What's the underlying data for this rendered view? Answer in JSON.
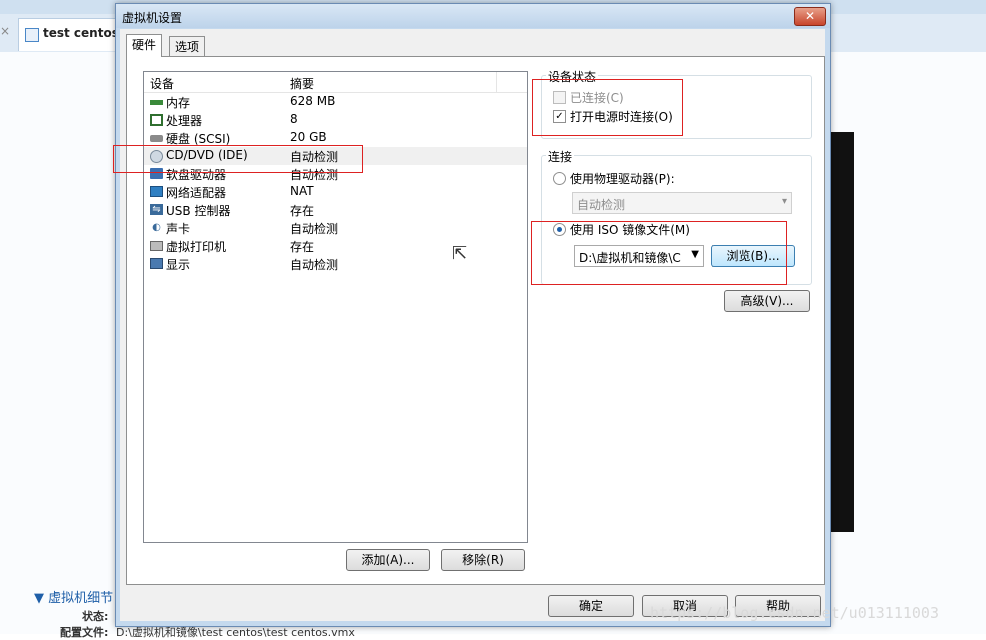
{
  "background": {
    "tab_label": "test centos",
    "close_glyph": "×",
    "details_title": "▼ 虚拟机细节",
    "status_label": "状态:",
    "config_label": "配置文件:",
    "config_value": "D:\\虚拟机和镜像\\test centos\\test centos.vmx"
  },
  "dialog": {
    "title": "虚拟机设置",
    "close_glyph": "✕",
    "tabs": [
      {
        "label": "硬件",
        "active": true
      },
      {
        "label": "选项",
        "active": false
      }
    ],
    "device_list": {
      "headers": {
        "device": "设备",
        "summary": "摘要"
      },
      "rows": [
        {
          "name": "内存",
          "summary": "628 MB",
          "icon": "memory-icon"
        },
        {
          "name": "处理器",
          "summary": "8",
          "icon": "processor-icon"
        },
        {
          "name": "硬盘 (SCSI)",
          "summary": "20 GB",
          "icon": "hard-disk-icon"
        },
        {
          "name": "CD/DVD (IDE)",
          "summary": "自动检测",
          "icon": "cd-dvd-icon",
          "selected": true
        },
        {
          "name": "软盘驱动器",
          "summary": "自动检测",
          "icon": "floppy-icon"
        },
        {
          "name": "网络适配器",
          "summary": "NAT",
          "icon": "network-adapter-icon"
        },
        {
          "name": "USB 控制器",
          "summary": "存在",
          "icon": "usb-icon"
        },
        {
          "name": "声卡",
          "summary": "自动检测",
          "icon": "sound-card-icon"
        },
        {
          "name": "虚拟打印机",
          "summary": "存在",
          "icon": "printer-icon"
        },
        {
          "name": "显示",
          "summary": "自动检测",
          "icon": "display-icon"
        }
      ],
      "add_button": "添加(A)...",
      "remove_button": "移除(R)"
    },
    "device_status": {
      "title": "设备状态",
      "connected_label": "已连接(C)",
      "connected_checked": false,
      "connect_at_power_on_label": "打开电源时连接(O)",
      "connect_at_power_on_checked": true
    },
    "connection": {
      "title": "连接",
      "physical_drive_label": "使用物理驱动器(P):",
      "physical_drive_value": "自动检测",
      "iso_label": "使用 ISO 镜像文件(M)",
      "iso_path": "D:\\虚拟机和镜像\\C",
      "browse_button": "浏览(B)...",
      "selected": "iso"
    },
    "advanced_button": "高级(V)...",
    "footer": {
      "ok": "确定",
      "cancel": "取消",
      "help": "帮助"
    }
  },
  "watermark": "https://blog.csdn.net/u013111003",
  "colors": {
    "title_bar": "#c4d9ee",
    "close_button": "#c8452c",
    "highlight_box": "#dd2222",
    "link_blue": "#1f5fa8"
  }
}
